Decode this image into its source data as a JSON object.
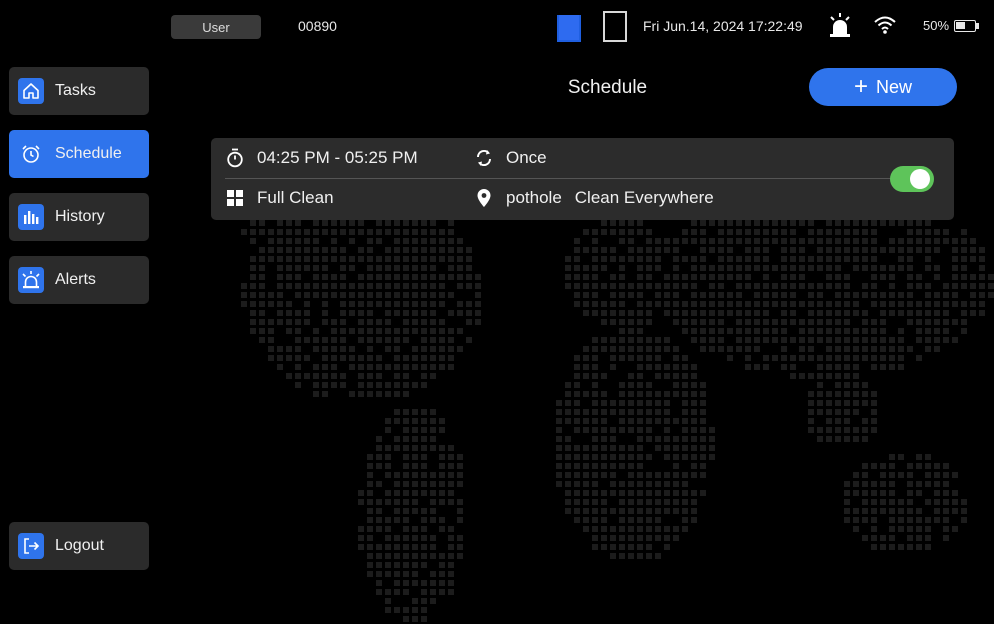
{
  "status_bar": {
    "user_label": "User",
    "device_id": "00890",
    "datetime": "Fri Jun.14, 2024 17:22:49",
    "battery": {
      "percent_label": "50%",
      "level": 0.5
    }
  },
  "sidebar": {
    "items": [
      {
        "label": "Tasks",
        "icon": "home-icon",
        "active": false
      },
      {
        "label": "Schedule",
        "icon": "alarm-clock-icon",
        "active": true
      },
      {
        "label": "History",
        "icon": "bar-chart-icon",
        "active": false
      },
      {
        "label": "Alerts",
        "icon": "siren-icon",
        "active": false
      }
    ],
    "logout_label": "Logout"
  },
  "header": {
    "title": "Schedule",
    "new_label": "New"
  },
  "schedule": [
    {
      "time_range": "04:25 PM - 05:25 PM",
      "repeat": "Once",
      "mode": "Full Clean",
      "map_name": "pothole",
      "area": "Clean Everywhere",
      "enabled": true
    }
  ],
  "colors": {
    "accent": "#2f74ec",
    "toggle_on": "#5ec45a",
    "card_bg": "#2c2c2c",
    "sidebar_bg": "#2b2b2b",
    "background": "#000000"
  }
}
